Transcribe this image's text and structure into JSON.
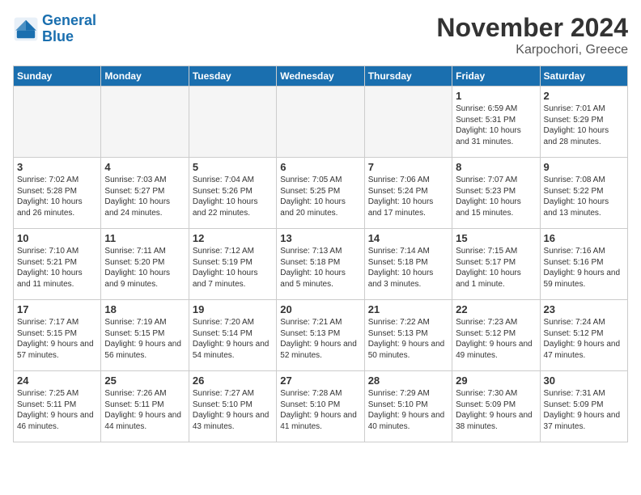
{
  "header": {
    "logo_line1": "General",
    "logo_line2": "Blue",
    "month": "November 2024",
    "location": "Karpochori, Greece"
  },
  "days_of_week": [
    "Sunday",
    "Monday",
    "Tuesday",
    "Wednesday",
    "Thursday",
    "Friday",
    "Saturday"
  ],
  "weeks": [
    [
      {
        "day": "",
        "empty": true
      },
      {
        "day": "",
        "empty": true
      },
      {
        "day": "",
        "empty": true
      },
      {
        "day": "",
        "empty": true
      },
      {
        "day": "",
        "empty": true
      },
      {
        "day": "1",
        "sunrise": "Sunrise: 6:59 AM",
        "sunset": "Sunset: 5:31 PM",
        "daylight": "Daylight: 10 hours and 31 minutes."
      },
      {
        "day": "2",
        "sunrise": "Sunrise: 7:01 AM",
        "sunset": "Sunset: 5:29 PM",
        "daylight": "Daylight: 10 hours and 28 minutes."
      }
    ],
    [
      {
        "day": "3",
        "sunrise": "Sunrise: 7:02 AM",
        "sunset": "Sunset: 5:28 PM",
        "daylight": "Daylight: 10 hours and 26 minutes."
      },
      {
        "day": "4",
        "sunrise": "Sunrise: 7:03 AM",
        "sunset": "Sunset: 5:27 PM",
        "daylight": "Daylight: 10 hours and 24 minutes."
      },
      {
        "day": "5",
        "sunrise": "Sunrise: 7:04 AM",
        "sunset": "Sunset: 5:26 PM",
        "daylight": "Daylight: 10 hours and 22 minutes."
      },
      {
        "day": "6",
        "sunrise": "Sunrise: 7:05 AM",
        "sunset": "Sunset: 5:25 PM",
        "daylight": "Daylight: 10 hours and 20 minutes."
      },
      {
        "day": "7",
        "sunrise": "Sunrise: 7:06 AM",
        "sunset": "Sunset: 5:24 PM",
        "daylight": "Daylight: 10 hours and 17 minutes."
      },
      {
        "day": "8",
        "sunrise": "Sunrise: 7:07 AM",
        "sunset": "Sunset: 5:23 PM",
        "daylight": "Daylight: 10 hours and 15 minutes."
      },
      {
        "day": "9",
        "sunrise": "Sunrise: 7:08 AM",
        "sunset": "Sunset: 5:22 PM",
        "daylight": "Daylight: 10 hours and 13 minutes."
      }
    ],
    [
      {
        "day": "10",
        "sunrise": "Sunrise: 7:10 AM",
        "sunset": "Sunset: 5:21 PM",
        "daylight": "Daylight: 10 hours and 11 minutes."
      },
      {
        "day": "11",
        "sunrise": "Sunrise: 7:11 AM",
        "sunset": "Sunset: 5:20 PM",
        "daylight": "Daylight: 10 hours and 9 minutes."
      },
      {
        "day": "12",
        "sunrise": "Sunrise: 7:12 AM",
        "sunset": "Sunset: 5:19 PM",
        "daylight": "Daylight: 10 hours and 7 minutes."
      },
      {
        "day": "13",
        "sunrise": "Sunrise: 7:13 AM",
        "sunset": "Sunset: 5:18 PM",
        "daylight": "Daylight: 10 hours and 5 minutes."
      },
      {
        "day": "14",
        "sunrise": "Sunrise: 7:14 AM",
        "sunset": "Sunset: 5:18 PM",
        "daylight": "Daylight: 10 hours and 3 minutes."
      },
      {
        "day": "15",
        "sunrise": "Sunrise: 7:15 AM",
        "sunset": "Sunset: 5:17 PM",
        "daylight": "Daylight: 10 hours and 1 minute."
      },
      {
        "day": "16",
        "sunrise": "Sunrise: 7:16 AM",
        "sunset": "Sunset: 5:16 PM",
        "daylight": "Daylight: 9 hours and 59 minutes."
      }
    ],
    [
      {
        "day": "17",
        "sunrise": "Sunrise: 7:17 AM",
        "sunset": "Sunset: 5:15 PM",
        "daylight": "Daylight: 9 hours and 57 minutes."
      },
      {
        "day": "18",
        "sunrise": "Sunrise: 7:19 AM",
        "sunset": "Sunset: 5:15 PM",
        "daylight": "Daylight: 9 hours and 56 minutes."
      },
      {
        "day": "19",
        "sunrise": "Sunrise: 7:20 AM",
        "sunset": "Sunset: 5:14 PM",
        "daylight": "Daylight: 9 hours and 54 minutes."
      },
      {
        "day": "20",
        "sunrise": "Sunrise: 7:21 AM",
        "sunset": "Sunset: 5:13 PM",
        "daylight": "Daylight: 9 hours and 52 minutes."
      },
      {
        "day": "21",
        "sunrise": "Sunrise: 7:22 AM",
        "sunset": "Sunset: 5:13 PM",
        "daylight": "Daylight: 9 hours and 50 minutes."
      },
      {
        "day": "22",
        "sunrise": "Sunrise: 7:23 AM",
        "sunset": "Sunset: 5:12 PM",
        "daylight": "Daylight: 9 hours and 49 minutes."
      },
      {
        "day": "23",
        "sunrise": "Sunrise: 7:24 AM",
        "sunset": "Sunset: 5:12 PM",
        "daylight": "Daylight: 9 hours and 47 minutes."
      }
    ],
    [
      {
        "day": "24",
        "sunrise": "Sunrise: 7:25 AM",
        "sunset": "Sunset: 5:11 PM",
        "daylight": "Daylight: 9 hours and 46 minutes."
      },
      {
        "day": "25",
        "sunrise": "Sunrise: 7:26 AM",
        "sunset": "Sunset: 5:11 PM",
        "daylight": "Daylight: 9 hours and 44 minutes."
      },
      {
        "day": "26",
        "sunrise": "Sunrise: 7:27 AM",
        "sunset": "Sunset: 5:10 PM",
        "daylight": "Daylight: 9 hours and 43 minutes."
      },
      {
        "day": "27",
        "sunrise": "Sunrise: 7:28 AM",
        "sunset": "Sunset: 5:10 PM",
        "daylight": "Daylight: 9 hours and 41 minutes."
      },
      {
        "day": "28",
        "sunrise": "Sunrise: 7:29 AM",
        "sunset": "Sunset: 5:10 PM",
        "daylight": "Daylight: 9 hours and 40 minutes."
      },
      {
        "day": "29",
        "sunrise": "Sunrise: 7:30 AM",
        "sunset": "Sunset: 5:09 PM",
        "daylight": "Daylight: 9 hours and 38 minutes."
      },
      {
        "day": "30",
        "sunrise": "Sunrise: 7:31 AM",
        "sunset": "Sunset: 5:09 PM",
        "daylight": "Daylight: 9 hours and 37 minutes."
      }
    ]
  ]
}
